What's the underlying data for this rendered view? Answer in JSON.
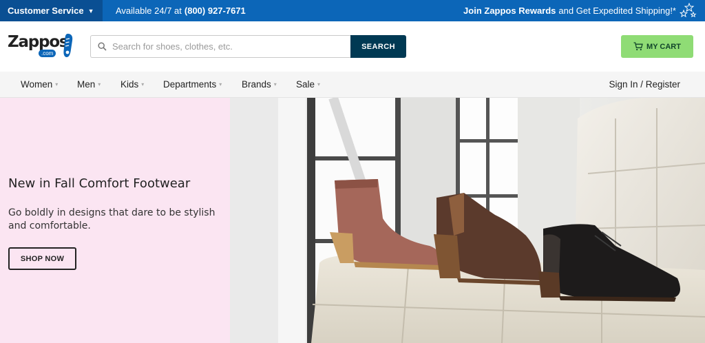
{
  "topbar": {
    "customer_service": "Customer Service",
    "available_text": "Available 24/7 at",
    "phone": "(800) 927-7671",
    "rewards_bold": "Join Zappos Rewards",
    "rewards_text": "and Get Expedited Shipping!*"
  },
  "header": {
    "logo_text": "Zappos",
    "logo_com": ".com",
    "search_placeholder": "Search for shoes, clothes, etc.",
    "search_button": "SEARCH",
    "cart_label": "MY CART"
  },
  "nav": {
    "items": [
      "Women",
      "Men",
      "Kids",
      "Departments",
      "Brands",
      "Sale"
    ],
    "signin": "Sign In / Register"
  },
  "hero": {
    "title": "New in Fall Comfort Footwear",
    "subtitle": "Go boldly in designs that dare to be stylish and comfortable.",
    "cta": "SHOP NOW"
  },
  "icons": {
    "search": "search-icon",
    "cart": "cart-icon",
    "caret": "chevron-down-icon",
    "stars": "stars-icon"
  },
  "colors": {
    "topbar": "#0c66b8",
    "customer_service_bg": "#0a4f93",
    "search_button": "#003953",
    "cart_button": "#8fdc75",
    "hero_left_bg": "#fbe5f2"
  }
}
